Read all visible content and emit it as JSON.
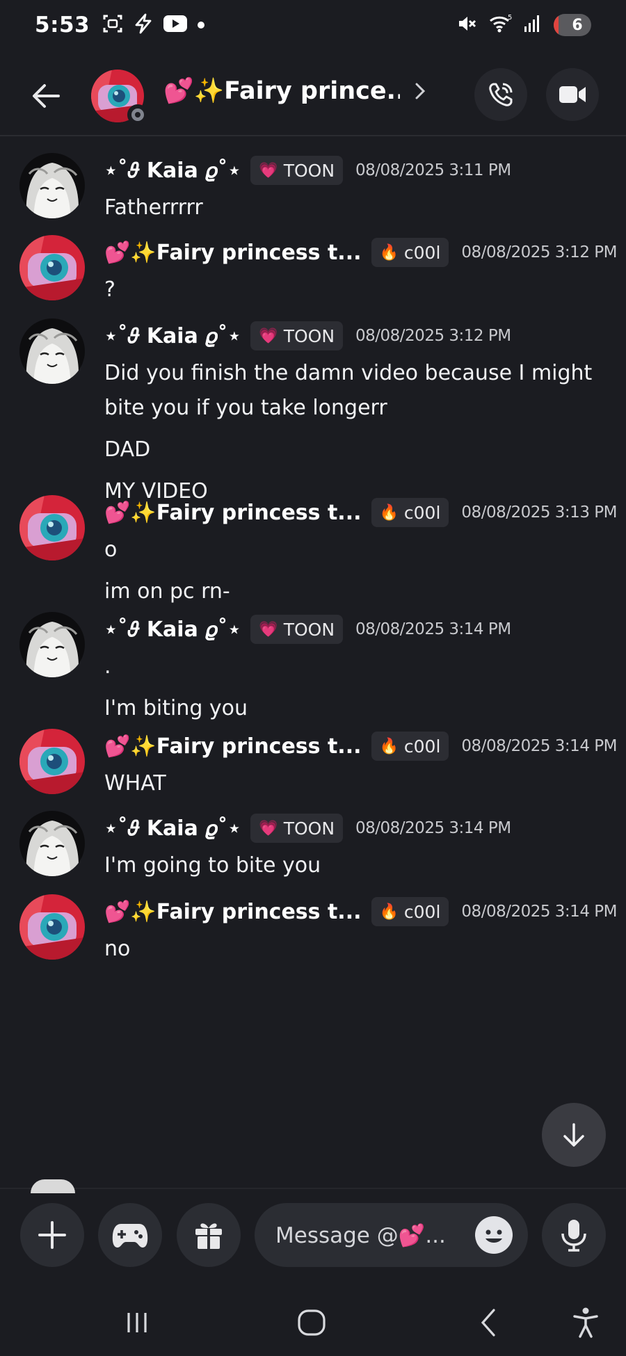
{
  "status_bar": {
    "time": "5:53",
    "battery_level": "6",
    "battery_fraction": 0.06,
    "icons": [
      "screenshot-icon",
      "flash-icon",
      "youtube-icon",
      "notification-dot-icon",
      "mute-icon",
      "wifi-icon",
      "signal-icon",
      "battery-icon"
    ]
  },
  "header": {
    "title": "💕✨Fairy prince...",
    "back_icon": "arrow-left-icon",
    "chevron_icon": "chevron-right-icon",
    "call_icon": "phone-call-icon",
    "video_icon": "video-camera-icon",
    "presence": "offline"
  },
  "users": {
    "kaia": {
      "name": "⋆˚𝜗 Kaia 𝜚˚⋆",
      "tag_icon": "💗",
      "tag": "TOON"
    },
    "fairy": {
      "name": "💕✨Fairy princess t...",
      "tag_icon": "🔥",
      "tag": "c00l"
    }
  },
  "messages": [
    {
      "user": "kaia",
      "timestamp": "08/08/2025 3:11 PM",
      "lines": [
        "Fatherrrrr"
      ]
    },
    {
      "user": "fairy",
      "timestamp": "08/08/2025 3:12 PM",
      "lines": [
        "?"
      ]
    },
    {
      "user": "kaia",
      "timestamp": "08/08/2025 3:12 PM",
      "lines": [
        "Did you finish the damn video because I might bite you if you take longerr",
        "DAD",
        "MY VIDEO"
      ]
    },
    {
      "user": "fairy",
      "timestamp": "08/08/2025 3:13 PM",
      "lines": [
        "o",
        "im on pc rn-"
      ]
    },
    {
      "user": "kaia",
      "timestamp": "08/08/2025 3:14 PM",
      "lines": [
        ".",
        "I'm biting you"
      ]
    },
    {
      "user": "fairy",
      "timestamp": "08/08/2025 3:14 PM",
      "lines": [
        "WHAT"
      ]
    },
    {
      "user": "kaia",
      "timestamp": "08/08/2025 3:14 PM",
      "lines": [
        "I'm going to bite you"
      ]
    },
    {
      "user": "fairy",
      "timestamp": "08/08/2025 3:14 PM",
      "lines": [
        "no"
      ]
    }
  ],
  "composer": {
    "placeholder": "Message @💕...",
    "buttons": [
      "plus-icon",
      "gamepad-icon",
      "gift-icon",
      "emoji-icon",
      "microphone-icon"
    ]
  },
  "scroll_down_icon": "arrow-down-icon",
  "nav": [
    "recents-icon",
    "home-icon",
    "back-icon",
    "accessibility-icon"
  ]
}
